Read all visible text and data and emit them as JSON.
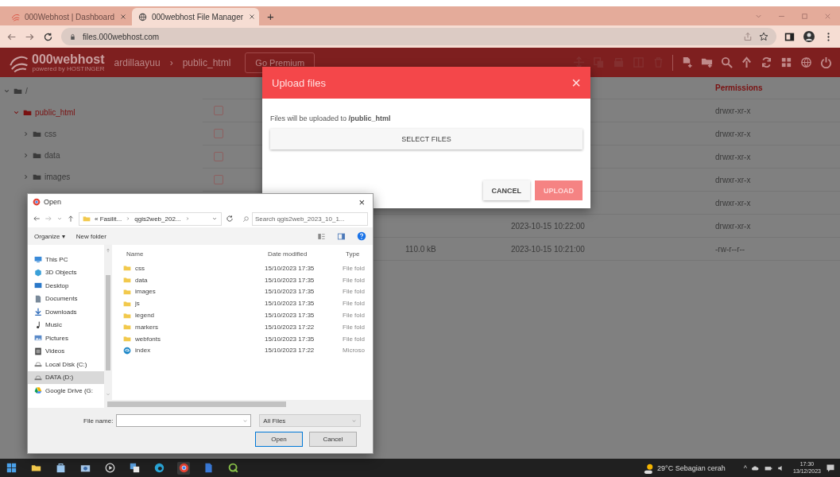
{
  "browser": {
    "tabs": [
      {
        "title": "000Webhost | Dashboard",
        "selected": false
      },
      {
        "title": "000webhost File Manager",
        "selected": true
      }
    ],
    "new_tab": "+",
    "url": "files.000webhost.com"
  },
  "app_header": {
    "logo": "000webhost",
    "logo_tagline": "powered by HOSTINGER",
    "breadcrumb": [
      "ardillaayuu",
      "public_html"
    ],
    "separator": "›",
    "premium_button": "Go Premium",
    "tools": [
      {
        "kind": "move",
        "disabled": true
      },
      {
        "kind": "copy",
        "disabled": true
      },
      {
        "kind": "archive",
        "disabled": true
      },
      {
        "kind": "extract",
        "disabled": true
      },
      {
        "kind": "delete",
        "disabled": true
      },
      {
        "kind": "divider"
      },
      {
        "kind": "new-file",
        "disabled": false
      },
      {
        "kind": "new-folder",
        "disabled": false
      },
      {
        "kind": "search",
        "disabled": false
      },
      {
        "kind": "upload",
        "disabled": false
      },
      {
        "kind": "refresh",
        "disabled": false
      },
      {
        "kind": "grid",
        "disabled": false
      },
      {
        "kind": "globe",
        "disabled": false
      },
      {
        "kind": "power",
        "disabled": false
      }
    ]
  },
  "tree": [
    {
      "label": "/",
      "expanded": true,
      "selected": false,
      "children": [
        {
          "label": "public_html",
          "expanded": true,
          "selected": true,
          "children": [
            {
              "label": "css",
              "expanded": false,
              "selected": false
            },
            {
              "label": "data",
              "expanded": false,
              "selected": false
            },
            {
              "label": "images",
              "expanded": false,
              "selected": false
            }
          ]
        }
      ]
    }
  ],
  "table": {
    "permissions_heading": "Permissions",
    "rows": [
      {
        "checked": false,
        "permissions": "drwxr-xr-x"
      },
      {
        "checked": false,
        "permissions": "drwxr-xr-x"
      },
      {
        "checked": false,
        "permissions": "drwxr-xr-x"
      },
      {
        "checked": false,
        "permissions": "drwxr-xr-x"
      },
      {
        "permissions": "drwxr-xr-x"
      },
      {
        "modified": "2023-10-15 10:22:00",
        "permissions": "drwxr-xr-x"
      },
      {
        "size": "110.0 kB",
        "modified": "2023-10-15 10:21:00",
        "permissions": "-rw-r--r--"
      }
    ]
  },
  "upload_modal": {
    "title": "Upload files",
    "close": "×",
    "message": "Files will be uploaded to **/public_html**",
    "select_button": "SELECT FILES",
    "cancel_button": "CANCEL",
    "upload_button": "UPLOAD",
    "upload_disabled": true
  },
  "open_dialog": {
    "title": "Open",
    "close": "×",
    "path": [
      "« Fasilit...",
      "qgis2web_202..."
    ],
    "search_placeholder": "Search qgis2web_2023_10_1...",
    "organize": "Organize ▾",
    "new_folder": "New folder",
    "nav": [
      {
        "label": "This PC",
        "kind": "pc",
        "selected": false
      },
      {
        "label": "3D Objects",
        "kind": "cube",
        "selected": false
      },
      {
        "label": "Desktop",
        "kind": "desktop",
        "selected": false
      },
      {
        "label": "Documents",
        "kind": "doc",
        "selected": false
      },
      {
        "label": "Downloads",
        "kind": "download",
        "selected": false
      },
      {
        "label": "Music",
        "kind": "music",
        "selected": false
      },
      {
        "label": "Pictures",
        "kind": "picture",
        "selected": false
      },
      {
        "label": "Videos",
        "kind": "video",
        "selected": false
      },
      {
        "label": "Local Disk (C:)",
        "kind": "disk",
        "selected": false
      },
      {
        "label": "DATA (D:)",
        "kind": "disk",
        "selected": true
      },
      {
        "label": "Google Drive (G:",
        "kind": "drive",
        "selected": false
      }
    ],
    "columns": [
      "Name",
      "Date modified",
      "Type"
    ],
    "files": [
      {
        "name": "css",
        "kind": "folder",
        "date": "15/10/2023 17:35",
        "type": "File fold"
      },
      {
        "name": "data",
        "kind": "folder",
        "date": "15/10/2023 17:35",
        "type": "File fold"
      },
      {
        "name": "images",
        "kind": "folder",
        "date": "15/10/2023 17:35",
        "type": "File fold"
      },
      {
        "name": "js",
        "kind": "folder",
        "date": "15/10/2023 17:35",
        "type": "File fold"
      },
      {
        "name": "legend",
        "kind": "folder",
        "date": "15/10/2023 17:35",
        "type": "File fold"
      },
      {
        "name": "markers",
        "kind": "folder",
        "date": "15/10/2023 17:22",
        "type": "File fold"
      },
      {
        "name": "webfonts",
        "kind": "folder",
        "date": "15/10/2023 17:35",
        "type": "File fold"
      },
      {
        "name": "index",
        "kind": "html",
        "date": "15/10/2023 17:22",
        "type": "Microso"
      }
    ],
    "file_name_label": "File name:",
    "file_type": "All Files",
    "open_button": "Open",
    "cancel_button": "Cancel"
  },
  "taskbar": {
    "apps": [
      {
        "kind": "start",
        "selected": false
      },
      {
        "kind": "folder",
        "selected": false
      },
      {
        "kind": "bag",
        "selected": false
      },
      {
        "kind": "camera",
        "selected": false
      },
      {
        "kind": "play",
        "selected": false
      },
      {
        "kind": "app",
        "selected": false
      },
      {
        "kind": "edge",
        "selected": false
      },
      {
        "kind": "chrome",
        "selected": true
      },
      {
        "kind": "doc",
        "selected": false
      },
      {
        "kind": "q",
        "selected": false
      }
    ],
    "weather": "29°C Sebagian cerah",
    "tray_chevron": "^",
    "time": "17:30",
    "date": "13/12/2023"
  }
}
